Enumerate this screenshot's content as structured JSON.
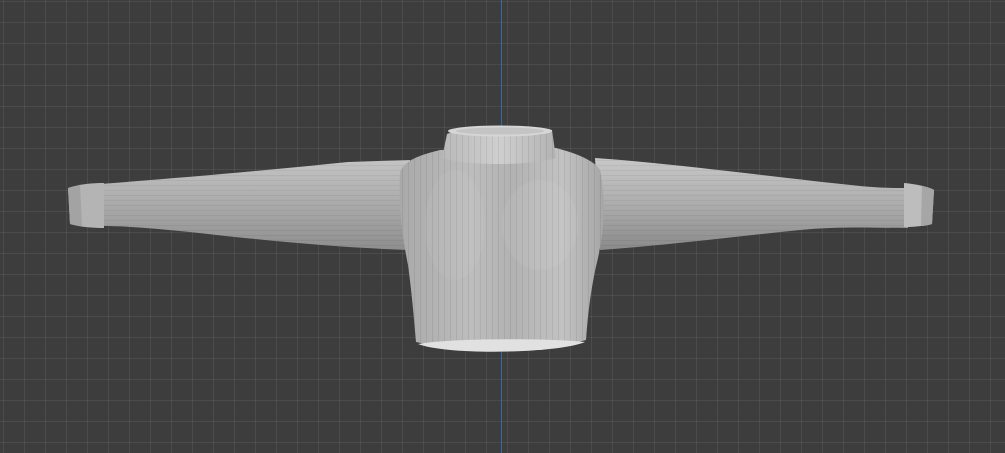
{
  "viewport": {
    "background_color": "#3d3d3d",
    "grid_color": "#4a4a4a",
    "axis_color": "#2f6ea8"
  },
  "object": {
    "name": "sweater",
    "shading": "solid",
    "base_color": "#b5b5b5",
    "shadow_color": "#8d8d8d",
    "highlight_color": "#d2d2d2"
  }
}
